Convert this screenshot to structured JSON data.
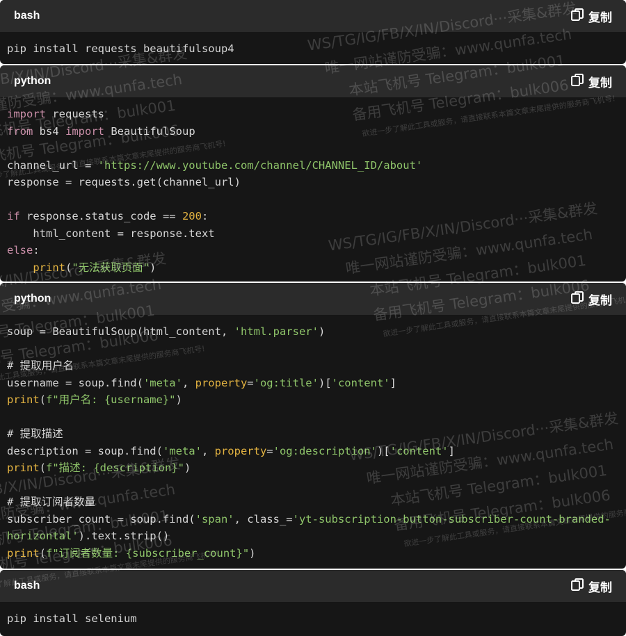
{
  "copy_label": "复制",
  "blocks": [
    {
      "language": "bash",
      "lines": [
        [
          {
            "t": "pip install requests beautifulsoup4",
            "c": ""
          }
        ]
      ]
    },
    {
      "language": "python",
      "lines": [
        [
          {
            "t": "import",
            "c": "kw"
          },
          {
            "t": " requests",
            "c": ""
          }
        ],
        [
          {
            "t": "from",
            "c": "kw"
          },
          {
            "t": " bs4 ",
            "c": ""
          },
          {
            "t": "import",
            "c": "kw"
          },
          {
            "t": " BeautifulSoup",
            "c": ""
          }
        ],
        [],
        [
          {
            "t": "channel_url = ",
            "c": ""
          },
          {
            "t": "'https://www.youtube.com/channel/CHANNEL_ID/about'",
            "c": "str"
          }
        ],
        [
          {
            "t": "response = requests.get(channel_url)",
            "c": ""
          }
        ],
        [],
        [
          {
            "t": "if",
            "c": "kw"
          },
          {
            "t": " response.status_code == ",
            "c": ""
          },
          {
            "t": "200",
            "c": "num"
          },
          {
            "t": ":",
            "c": ""
          }
        ],
        [
          {
            "t": "    html_content = response.text",
            "c": ""
          }
        ],
        [
          {
            "t": "else",
            "c": "kw"
          },
          {
            "t": ":",
            "c": ""
          }
        ],
        [
          {
            "t": "    ",
            "c": ""
          },
          {
            "t": "print",
            "c": "fn"
          },
          {
            "t": "(",
            "c": ""
          },
          {
            "t": "\"无法获取页面\"",
            "c": "str"
          },
          {
            "t": ")",
            "c": ""
          }
        ]
      ]
    },
    {
      "language": "python",
      "lines": [
        [
          {
            "t": "soup = BeautifulSoup(html_content, ",
            "c": ""
          },
          {
            "t": "'html.parser'",
            "c": "str"
          },
          {
            "t": ")",
            "c": ""
          }
        ],
        [],
        [
          {
            "t": "# 提取用户名",
            "c": "cm"
          }
        ],
        [
          {
            "t": "username = soup.find(",
            "c": ""
          },
          {
            "t": "'meta'",
            "c": "str"
          },
          {
            "t": ", ",
            "c": ""
          },
          {
            "t": "property",
            "c": "pm"
          },
          {
            "t": "=",
            "c": ""
          },
          {
            "t": "'og:title'",
            "c": "str"
          },
          {
            "t": ")[",
            "c": ""
          },
          {
            "t": "'content'",
            "c": "str"
          },
          {
            "t": "]",
            "c": ""
          }
        ],
        [
          {
            "t": "print",
            "c": "fn"
          },
          {
            "t": "(",
            "c": ""
          },
          {
            "t": "f\"用户名: {username}\"",
            "c": "str"
          },
          {
            "t": ")",
            "c": ""
          }
        ],
        [],
        [
          {
            "t": "# 提取描述",
            "c": "cm"
          }
        ],
        [
          {
            "t": "description = soup.find(",
            "c": ""
          },
          {
            "t": "'meta'",
            "c": "str"
          },
          {
            "t": ", ",
            "c": ""
          },
          {
            "t": "property",
            "c": "pm"
          },
          {
            "t": "=",
            "c": ""
          },
          {
            "t": "'og:description'",
            "c": "str"
          },
          {
            "t": ")[",
            "c": ""
          },
          {
            "t": "'content'",
            "c": "str"
          },
          {
            "t": "]",
            "c": ""
          }
        ],
        [
          {
            "t": "print",
            "c": "fn"
          },
          {
            "t": "(",
            "c": ""
          },
          {
            "t": "f\"描述: {description}\"",
            "c": "str"
          },
          {
            "t": ")",
            "c": ""
          }
        ],
        [],
        [
          {
            "t": "# 提取订阅者数量",
            "c": "cm"
          }
        ],
        [
          {
            "t": "subscriber_count = soup.find(",
            "c": ""
          },
          {
            "t": "'span'",
            "c": "str"
          },
          {
            "t": ", class_=",
            "c": ""
          },
          {
            "t": "'yt-subscription-button-subscriber-count-branded-",
            "c": "str"
          }
        ],
        [
          {
            "t": "horizontal'",
            "c": "str"
          },
          {
            "t": ").text.strip()",
            "c": ""
          }
        ],
        [
          {
            "t": "print",
            "c": "fn"
          },
          {
            "t": "(",
            "c": ""
          },
          {
            "t": "f\"订阅者数量: {subscriber_count}\"",
            "c": "str"
          },
          {
            "t": ")",
            "c": ""
          }
        ]
      ]
    },
    {
      "language": "bash",
      "lines": [
        [
          {
            "t": "pip install selenium",
            "c": ""
          }
        ]
      ]
    }
  ],
  "watermark": {
    "lines": [
      "WS/TG/IG/FB/X/IN/Discord···采集&群发",
      "唯一网站谨防受骗：www.qunfa.tech",
      "本站飞机号 Telegram：bulk001",
      "备用飞机号 Telegram：bulk006",
      "欲进一步了解此工具或服务，请直接联系本篇文章末尾提供的服务商飞机号!"
    ]
  },
  "colors": {
    "background": "#161616",
    "header": "#2b2b2b",
    "keyword": "#c98ea8",
    "function": "#e3b341",
    "string": "#8fc56a",
    "text": "#d6d6d6"
  }
}
